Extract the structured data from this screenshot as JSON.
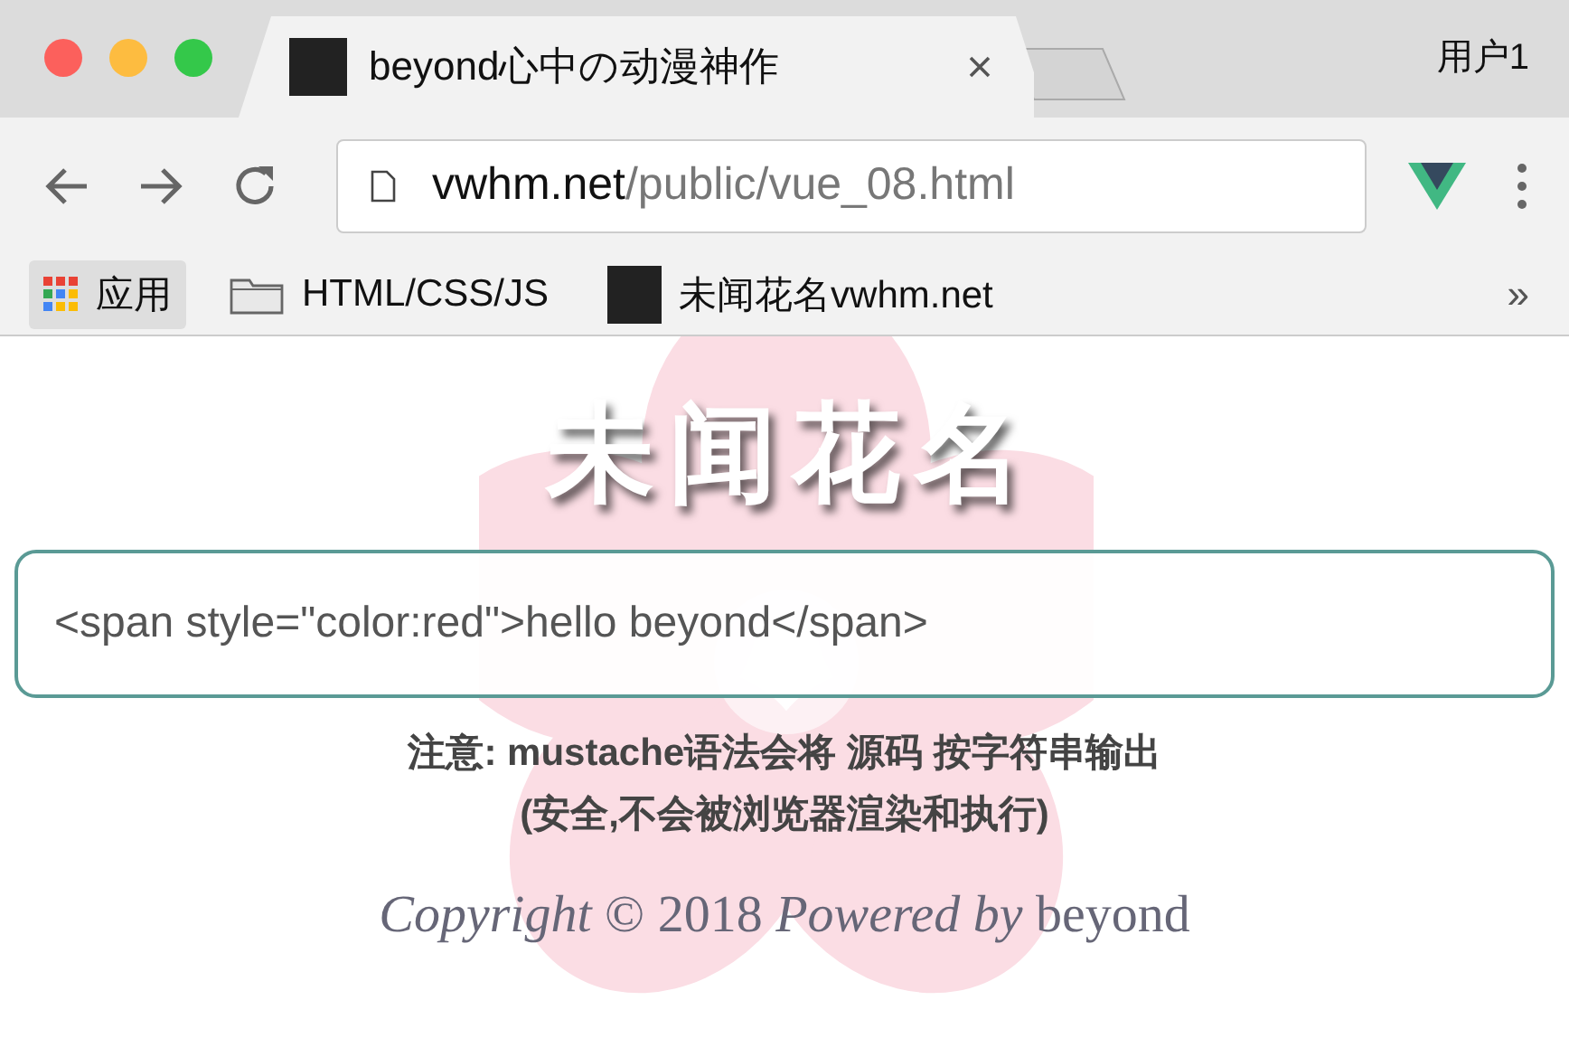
{
  "window": {
    "user": "用户1"
  },
  "tabs": [
    {
      "title": "beyond心中の动漫神作",
      "selected": true
    }
  ],
  "address_bar": {
    "domain": "vwhm.net",
    "path": "/public/vue_08.html"
  },
  "bookmarks": [
    {
      "kind": "apps",
      "label": "应用"
    },
    {
      "kind": "folder",
      "label": "HTML/CSS/JS"
    },
    {
      "kind": "site",
      "label": "未闻花名vwhm.net"
    }
  ],
  "bookmarks_overflow": "»",
  "page": {
    "heading": "未闻花名",
    "output": "<span style=\"color:red\">hello beyond</span>",
    "note_lines": [
      "注意: mustache语法会将 源码 按字符串输出",
      "(安全,不会被浏览器渲染和执行)"
    ],
    "footer": "*Copyright* © 2018 *Powered by* beyond"
  }
}
